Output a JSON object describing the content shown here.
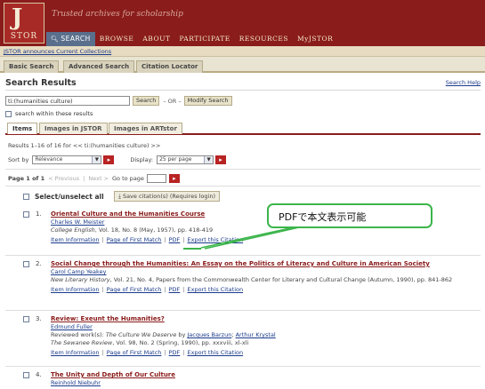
{
  "header": {
    "logo_mark": "J",
    "logo_word": "STOR",
    "tagline": "Trusted archives for scholarship",
    "nav": [
      {
        "label": "SEARCH",
        "active": true
      },
      {
        "label": "BROWSE",
        "active": false
      },
      {
        "label": "ABOUT",
        "active": false
      },
      {
        "label": "PARTICIPATE",
        "active": false
      },
      {
        "label": "RESOURCES",
        "active": false
      },
      {
        "label": "MyJSTOR",
        "active": false
      }
    ]
  },
  "announcement": "JSTOR announces Current Collections",
  "subtabs": [
    "Basic Search",
    "Advanced Search",
    "Citation Locator"
  ],
  "page": {
    "title": "Search Results",
    "help": "Search Help"
  },
  "query": {
    "value": "ti:(humanities culture)",
    "search_label": "Search",
    "or_text": "– OR –",
    "modify_label": "Modify Search",
    "within_label": "search within these results"
  },
  "result_tabs": [
    "Items",
    "Images in JSTOR",
    "Images in ARTstor"
  ],
  "summary": "Results 1–16 of 16 for << ti:(humanities culture) >>",
  "sort": {
    "label": "Sort by",
    "value": "Relevance",
    "display_label": "Display:",
    "display_value": "25 per page"
  },
  "pagination": {
    "page_of": "Page 1 of 1",
    "previous": "< Previous",
    "next": "Next >",
    "goto": "Go to page"
  },
  "select_all": "Select/unselect all",
  "save_citations": "Save citation(s) (Requires login)",
  "results": [
    {
      "num": "1.",
      "title": "Oriental Culture and the Humanities Course",
      "author": "Charles W. Meister",
      "journal": "College English",
      "cite": ", Vol. 18, No. 8 (May, 1957), pp. 418-419",
      "links": [
        "Item Information",
        "Page of First Match",
        "PDF",
        "Export this Citation"
      ]
    },
    {
      "num": "2.",
      "title": "Social Change through the Humanities: An Essay on the Politics of Literacy and Culture in American Society",
      "author": "Carol Camp Yeakey",
      "journal": "New Literary History",
      "cite": ", Vol. 21, No. 4, Papers from the Commonwealth Center for Literary and Cultural Change (Autumn, 1990), pp. 841-862",
      "links": [
        "Item Information",
        "Page of First Match",
        "PDF",
        "Export this Citation"
      ]
    },
    {
      "num": "3.",
      "title": "Review: Exeunt the Humanities?",
      "author": "Edmund Fuller",
      "review_prefix": "Reviewed work(s): ",
      "review_work": "The Culture We Deserve",
      "review_by": " by ",
      "review_author1": "Jacques Barzun",
      "review_sep": "; ",
      "review_author2": "Arthur Krystal",
      "journal": "The Sewanee Review",
      "cite": ", Vol. 98, No. 2 (Spring, 1990), pp. xxxviii, xl-xli",
      "links": [
        "Item Information",
        "Page of First Match",
        "PDF",
        "Export this Citation"
      ]
    },
    {
      "num": "4.",
      "title": "The Unity and Depth of Our Culture",
      "author": "Reinhold Niebuhr"
    }
  ],
  "callout": "PDFで本文表示可能",
  "colors": {
    "header": "#8a1c1c",
    "nav_active": "#5a6f8c",
    "result_title": "#8a1a1a",
    "link": "#1a3a8a",
    "callout": "#3bb54a"
  }
}
